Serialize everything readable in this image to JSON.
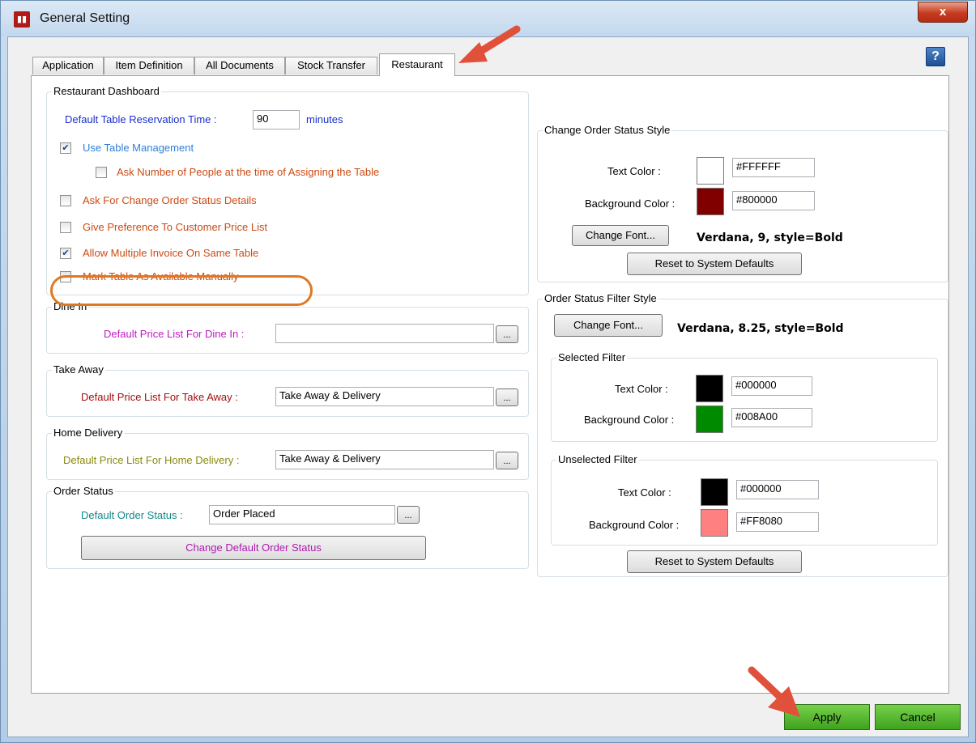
{
  "window": {
    "title": "General Setting",
    "close_label": "x",
    "help_label": "?"
  },
  "tabs": [
    {
      "label": "Application"
    },
    {
      "label": "Item Definition"
    },
    {
      "label": "All Documents"
    },
    {
      "label": "Stock Transfer"
    },
    {
      "label": "Restaurant",
      "active": true
    }
  ],
  "restaurant_dashboard": {
    "title": "Restaurant Dashboard",
    "reservation_label": "Default Table Reservation Time :",
    "reservation_value": "90",
    "reservation_unit": "minutes",
    "use_table_management": {
      "label": "Use Table Management",
      "checked": true
    },
    "ask_people": {
      "label": "Ask Number of People at the time of Assigning the Table",
      "checked": false
    },
    "ask_change_status": {
      "label": "Ask For Change Order Status Details",
      "checked": false
    },
    "give_preference": {
      "label": "Give Preference To Customer  Price List",
      "checked": false
    },
    "allow_multiple_invoice": {
      "label": "Allow Multiple Invoice On Same Table",
      "checked": true
    },
    "mark_available": {
      "label": "Mark Table As Available Manually",
      "checked": false
    }
  },
  "dine_in": {
    "title": "Dine In",
    "label": "Default Price List For Dine In :",
    "value": "",
    "browse": "..."
  },
  "take_away": {
    "title": "Take Away",
    "label": "Default Price List For Take Away :",
    "value": "Take Away & Delivery",
    "browse": "..."
  },
  "home_delivery": {
    "title": "Home Delivery",
    "label": "Default Price List For Home Delivery :",
    "value": "Take Away & Delivery",
    "browse": "..."
  },
  "order_status": {
    "title": "Order Status",
    "label": "Default Order Status :",
    "value": "Order Placed",
    "browse": "...",
    "change_button": "Change Default Order Status"
  },
  "change_order_status_style": {
    "title": "Change Order Status Style",
    "text_color_label": "Text Color :",
    "text_color_value": "#FFFFFF",
    "bg_color_label": "Background Color :",
    "bg_color_value": "#800000",
    "change_font_button": "Change Font...",
    "font_desc": "Verdana, 9, style=Bold",
    "reset_button": "Reset to System Defaults"
  },
  "order_status_filter_style": {
    "title": "Order Status Filter Style",
    "change_font_button": "Change Font...",
    "font_desc": "Verdana, 8.25, style=Bold",
    "selected": {
      "title": "Selected Filter",
      "text_color_label": "Text Color :",
      "text_color_value": "#000000",
      "bg_color_label": "Background Color :",
      "bg_color_value": "#008A00"
    },
    "unselected": {
      "title": "Unselected Filter",
      "text_color_label": "Text Color :",
      "text_color_value": "#000000",
      "bg_color_label": "Background Color :",
      "bg_color_value": "#FF8080"
    },
    "reset_button": "Reset to System Defaults"
  },
  "footer": {
    "apply_label": "Apply",
    "cancel_label": "Cancel"
  },
  "colors": {
    "label_blue": "#1a2fcf",
    "label_lightblue": "#2f7fd8",
    "label_orange": "#cc4a12",
    "label_magenta": "#c21ac2",
    "label_darkred": "#a01010",
    "label_olive": "#8a8a10",
    "label_teal": "#13888a",
    "annotation_arrow": "#e0503a",
    "highlight_ring": "#e07820"
  }
}
